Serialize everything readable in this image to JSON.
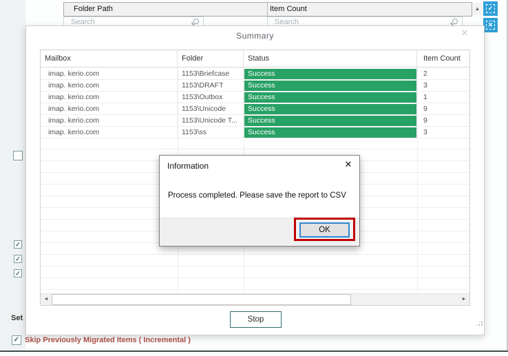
{
  "background": {
    "columns": [
      {
        "label": "Folder Path"
      },
      {
        "label": "Item Count"
      }
    ],
    "search": {
      "placeholder": "Search"
    },
    "scroll_up_icon": "▲",
    "select_all_icon": "✓",
    "clear_all_icon": "✕",
    "checkbox_check": "✓",
    "set_label": "Set",
    "skip_incremental_label": "Skip Previously Migrated Items ( Incremental )"
  },
  "summary_dialog": {
    "title": "Summary",
    "close_icon": "✕",
    "table": {
      "columns": [
        "Mailbox",
        "Folder",
        "Status",
        "Item Count"
      ],
      "rows": [
        {
          "mailbox": "imap. kerio.com",
          "folder": "1153\\Briefcase",
          "status": "Success",
          "count": "2"
        },
        {
          "mailbox": "imap. kerio.com",
          "folder": "1153\\DRAFT",
          "status": "Success",
          "count": "3"
        },
        {
          "mailbox": "imap. kerio.com",
          "folder": "1153\\Outbox",
          "status": "Success",
          "count": "1"
        },
        {
          "mailbox": "imap. kerio.com",
          "folder": "1153\\Unicode",
          "status": "Success",
          "count": "9"
        },
        {
          "mailbox": "imap. kerio.com",
          "folder": "1153\\Unicode T...",
          "status": "Success",
          "count": "9"
        },
        {
          "mailbox": "imap. kerio.com",
          "folder": "1153\\ss",
          "status": "Success",
          "count": "3"
        }
      ]
    },
    "scrollbar": {
      "left_icon": "◄",
      "right_icon": "►"
    },
    "stop_label": "Stop"
  },
  "info_dialog": {
    "title": "Information",
    "close_icon": "✕",
    "message": "Process completed. Please save the report to CSV",
    "ok_label": "OK"
  },
  "colors": {
    "success_green": "#28a164",
    "accent_blue": "#2f9fd8",
    "annotation_red": "#c00000",
    "warning_text": "#b0544a",
    "teal_border": "#2e6e6e",
    "focus_blue": "#2e86d0"
  }
}
